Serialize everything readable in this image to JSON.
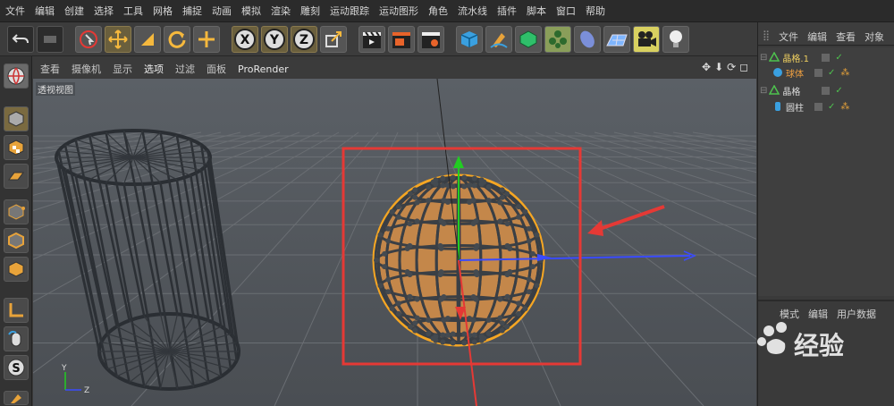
{
  "menubar": {
    "items": [
      "文件",
      "编辑",
      "创建",
      "选择",
      "工具",
      "网格",
      "捕捉",
      "动画",
      "模拟",
      "渲染",
      "雕刻",
      "运动跟踪",
      "运动图形",
      "角色",
      "流水线",
      "插件",
      "脚本",
      "窗口",
      "帮助"
    ]
  },
  "toolbar": {
    "x_label": "X",
    "y_label": "Y",
    "z_label": "Z"
  },
  "viewport": {
    "menu": [
      "查看",
      "摄像机",
      "显示",
      "选项",
      "过滤",
      "面板"
    ],
    "renderer": "ProRender",
    "label": "透视视图",
    "axis_y": "Y",
    "axis_z": "Z"
  },
  "object_manager": {
    "menu": [
      "文件",
      "编辑",
      "查看",
      "对象"
    ],
    "rows": [
      {
        "name": "晶格.1"
      },
      {
        "name": "球体"
      },
      {
        "name": "晶格"
      },
      {
        "name": "圆柱"
      }
    ]
  },
  "attribute_manager": {
    "menu": [
      "模式",
      "编辑",
      "用户数据"
    ]
  },
  "watermark": {
    "text": "经验"
  },
  "colors": {
    "highlight_box": "#e53935",
    "arrow": "#e53935",
    "selection_outline": "#f5a623",
    "axis_x": "#3a4bff",
    "axis_y": "#22cc22",
    "axis_z": "#e53935"
  }
}
